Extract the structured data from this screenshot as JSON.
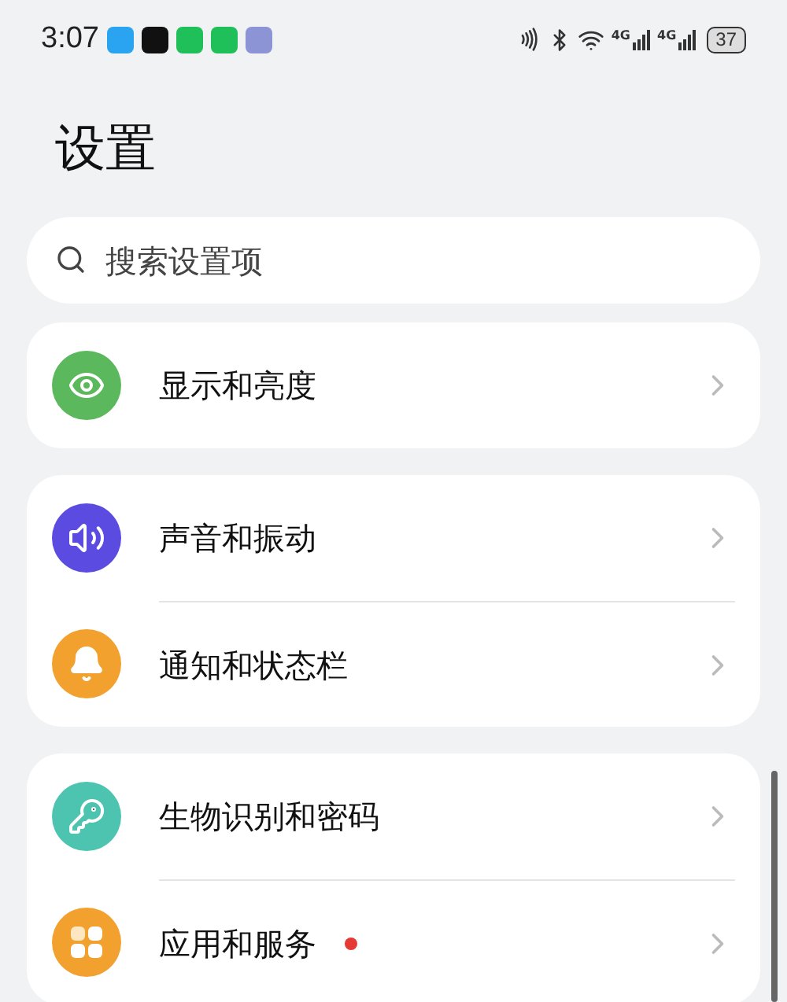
{
  "status_bar": {
    "time": "3:07",
    "network_labels": [
      "4G",
      "4G"
    ],
    "battery": "37"
  },
  "title": "设置",
  "search": {
    "placeholder": "搜索设置项"
  },
  "groups": [
    {
      "items": [
        {
          "label": "显示和亮度",
          "badge_dot": false
        }
      ]
    },
    {
      "items": [
        {
          "label": "声音和振动",
          "badge_dot": false
        },
        {
          "label": "通知和状态栏",
          "badge_dot": false
        }
      ]
    },
    {
      "items": [
        {
          "label": "生物识别和密码",
          "badge_dot": false
        },
        {
          "label": "应用和服务",
          "badge_dot": true
        }
      ]
    }
  ]
}
